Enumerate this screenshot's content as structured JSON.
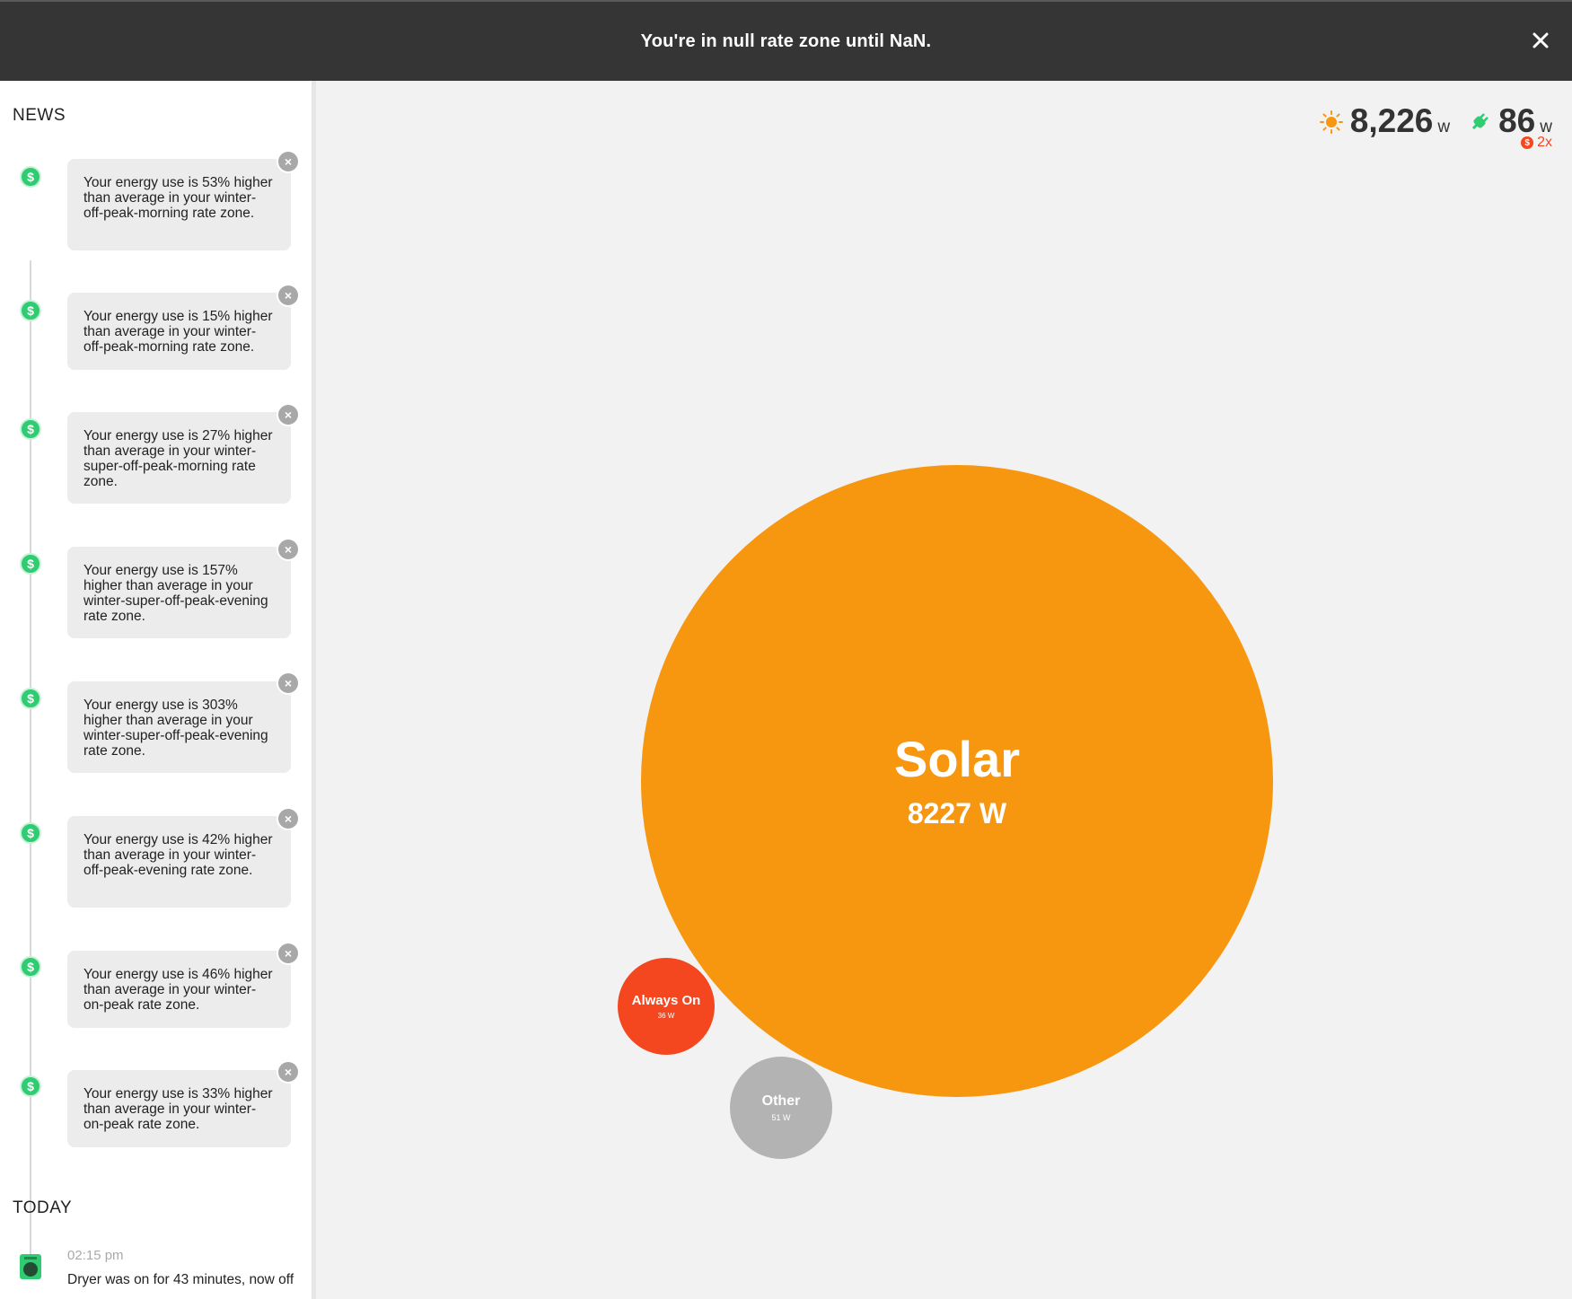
{
  "banner": {
    "text": "You're in null rate zone until NaN."
  },
  "sidebar": {
    "news_title": "NEWS",
    "news": [
      {
        "text": "Your energy use is 53% higher than average in your winter-off-peak-morning rate zone."
      },
      {
        "text": "Your energy use is 15% higher than average in your winter-off-peak-morning rate zone."
      },
      {
        "text": "Your energy use is 27% higher than average in your winter-super-off-peak-morning rate zone."
      },
      {
        "text": "Your energy use is 157% higher than average in your winter-super-off-peak-evening rate zone."
      },
      {
        "text": "Your energy use is 303% higher than average in your winter-super-off-peak-evening rate zone."
      },
      {
        "text": "Your energy use is 42% higher than average in your winter-off-peak-evening rate zone."
      },
      {
        "text": "Your energy use is 46% higher than average in your winter-on-peak rate zone."
      },
      {
        "text": "Your energy use is 33% higher than average in your winter-on-peak rate zone."
      }
    ],
    "today_title": "TODAY",
    "today": [
      {
        "time": "02:15 pm",
        "text": "Dryer was on for 43 minutes, now off"
      }
    ]
  },
  "stats": {
    "solar_value": "8,226",
    "solar_unit": "w",
    "usage_value": "86",
    "usage_unit": "w",
    "rate_multiplier": "2x"
  },
  "bubbles": {
    "solar": {
      "name": "Solar",
      "watts": "8227 W"
    },
    "always_on": {
      "name": "Always On",
      "watts": "36 W"
    },
    "other": {
      "name": "Other",
      "watts": "51 W"
    }
  },
  "colors": {
    "solar": "#f7960f",
    "always_on": "#f4471f",
    "other": "#b3b3b3",
    "news_icon": "#2fcc72",
    "banner": "#353535"
  }
}
